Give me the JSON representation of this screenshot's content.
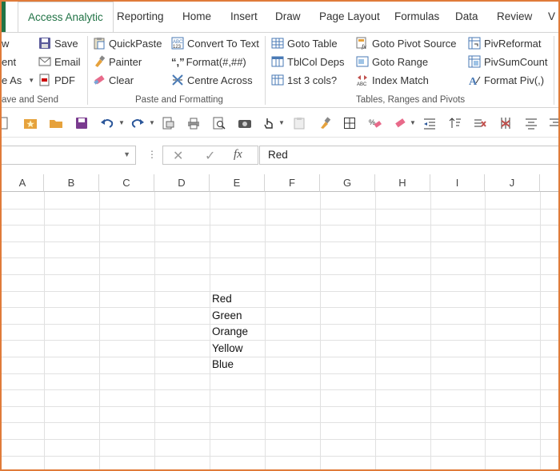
{
  "tabs": [
    {
      "label": "Access Analytic",
      "active": true
    },
    {
      "label": "Reporting"
    },
    {
      "label": "Home"
    },
    {
      "label": "Insert"
    },
    {
      "label": "Draw"
    },
    {
      "label": "Page Layout"
    },
    {
      "label": "Formulas"
    },
    {
      "label": "Data"
    },
    {
      "label": "Review"
    },
    {
      "label": "V"
    }
  ],
  "ribbon": {
    "save_send": {
      "left_items": [
        "w",
        "ent",
        "e As"
      ],
      "items": [
        "Save",
        "Email",
        "PDF"
      ],
      "label": "ave and Send"
    },
    "paste_format": {
      "col1": [
        "QuickPaste",
        "Painter",
        "Clear"
      ],
      "col2": [
        "Convert To Text",
        "Format(#,##)",
        "Centre Across"
      ],
      "format_prefix": "“,”",
      "label": "Paste and Formatting"
    },
    "tables": {
      "col1": [
        "Goto Table",
        "TblCol Deps",
        "1st 3 cols?"
      ],
      "col2": [
        "Goto Pivot Source",
        "Goto Range",
        "Index Match"
      ],
      "col3": [
        "PivReformat",
        "PivSumCount",
        "Format Piv(,)"
      ],
      "label": "Tables, Ranges and Pivots"
    }
  },
  "formula_bar": {
    "name_box": "",
    "dots": "⋮",
    "cancel": "✕",
    "enter": "✓",
    "fx": "fx",
    "value": "Red"
  },
  "columns": [
    "A",
    "B",
    "C",
    "D",
    "E",
    "F",
    "G",
    "H",
    "I",
    "J"
  ],
  "cells": [
    {
      "ref": "E8",
      "value": "Red"
    },
    {
      "ref": "E9",
      "value": "Green"
    },
    {
      "ref": "E10",
      "value": "Orange"
    },
    {
      "ref": "E11",
      "value": "Yellow"
    },
    {
      "ref": "E12",
      "value": "Blue"
    }
  ],
  "colors": {
    "accent": "#217346",
    "frame": "#e07b39",
    "grid": "#e1e1e1"
  }
}
